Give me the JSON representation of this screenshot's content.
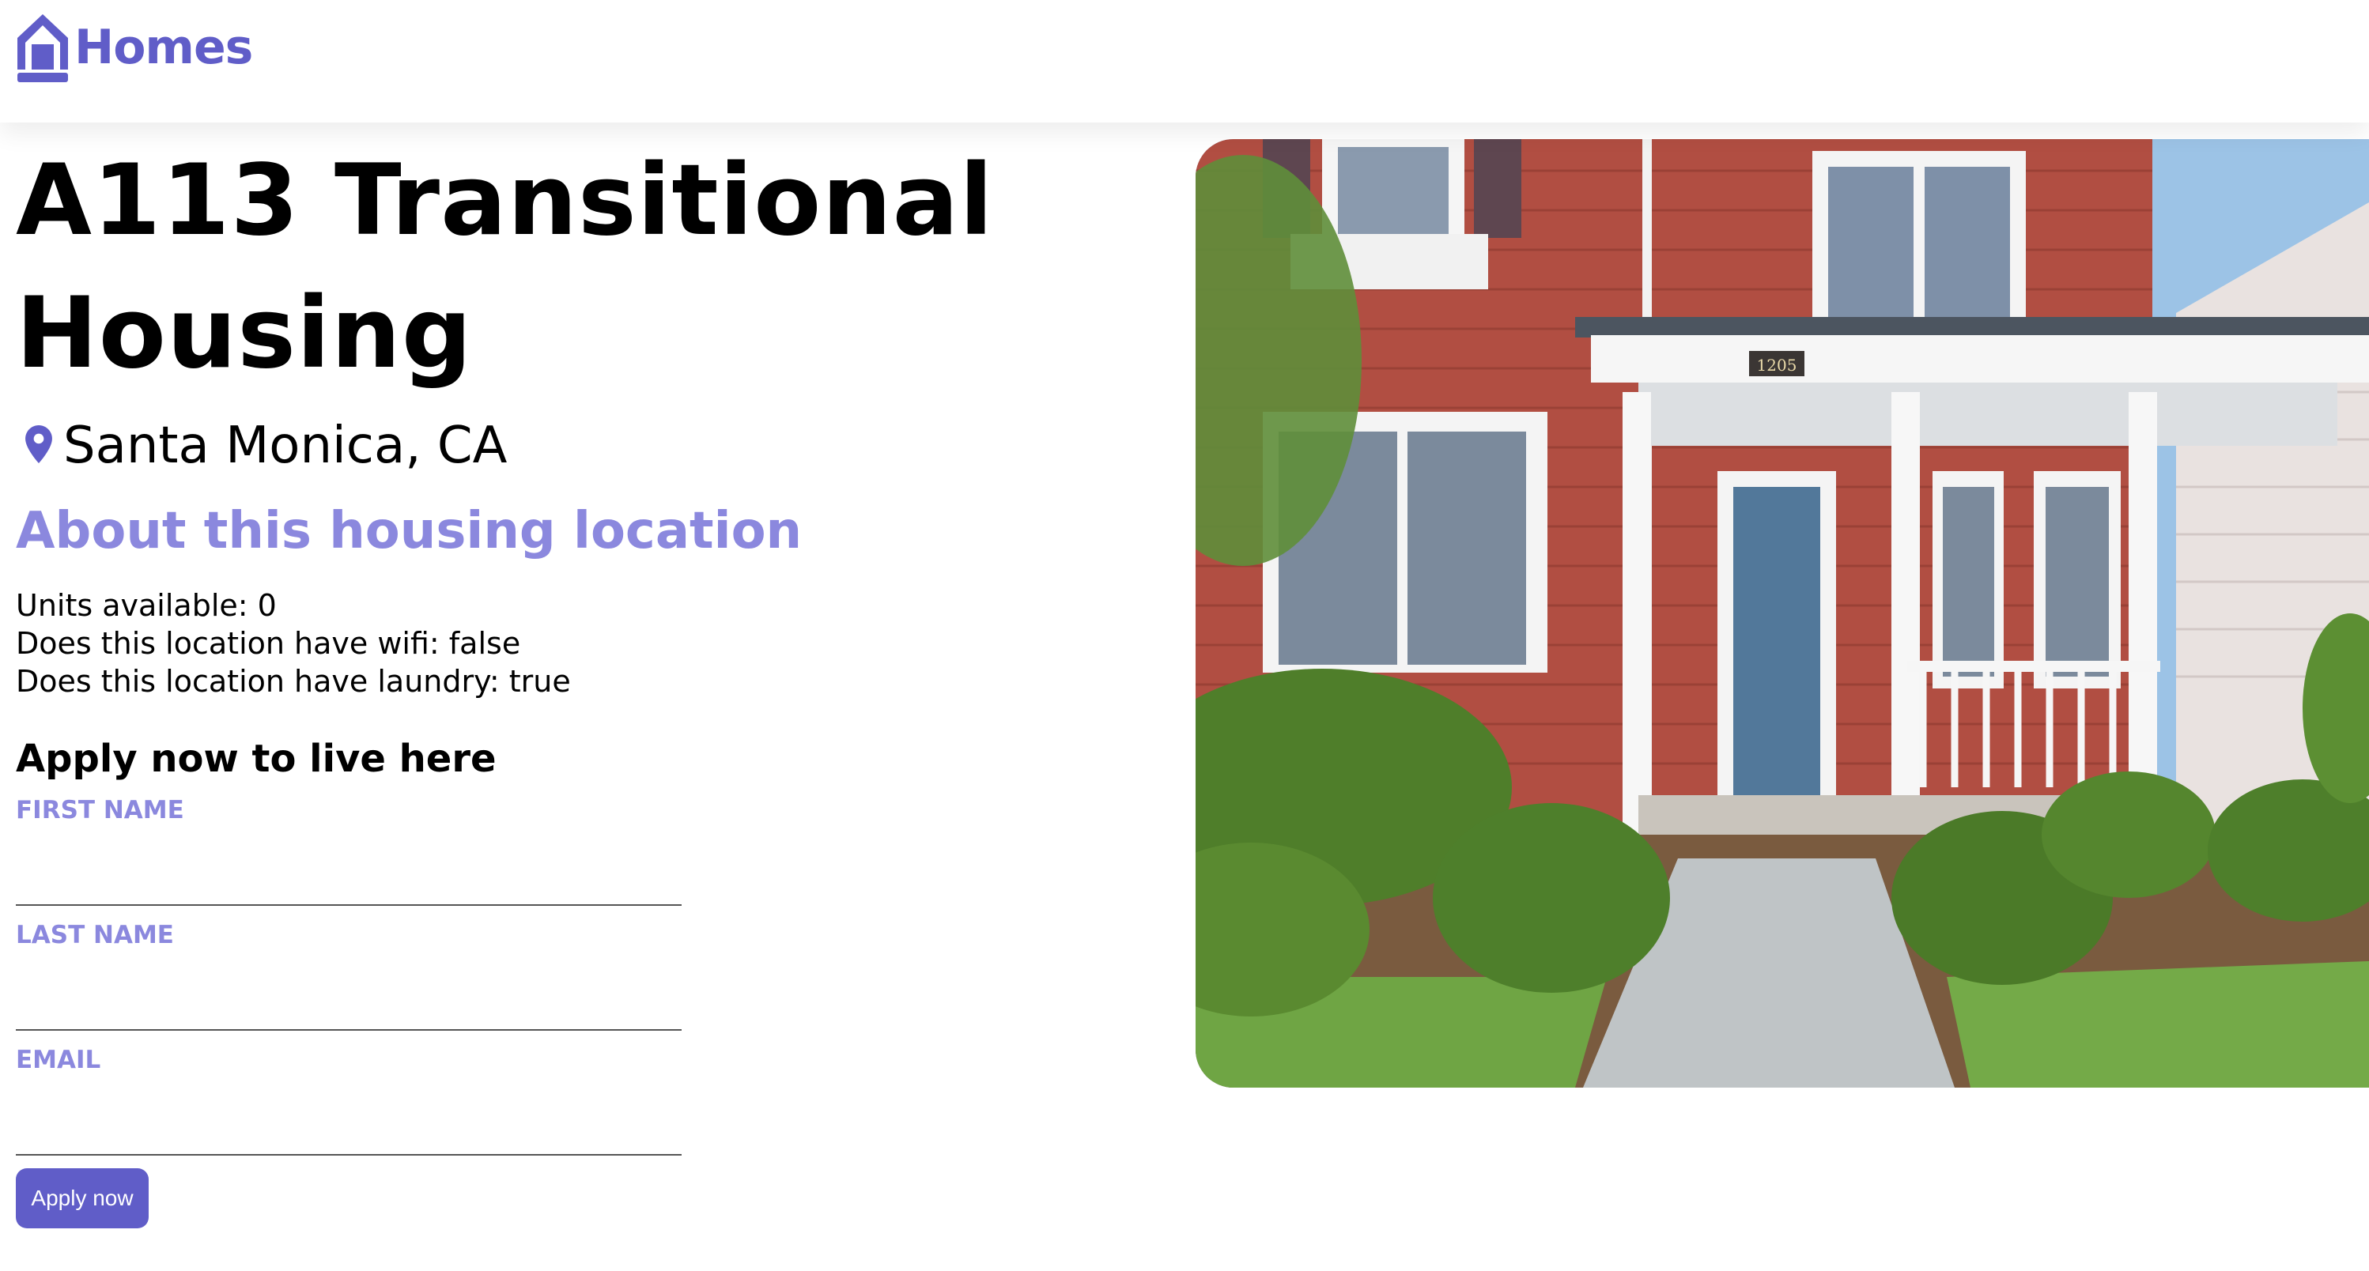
{
  "header": {
    "brand_label": "Homes",
    "brand_icon": "house-icon"
  },
  "listing": {
    "title": "A113 Transitional Housing",
    "location": "Santa Monica, CA",
    "location_icon": "map-pin-icon",
    "photo_alt": "Exterior of a red house with a white porch",
    "house_number": "1205",
    "about_heading": "About this housing location",
    "features": [
      "Units available: 0",
      "Does this location have wifi: false",
      "Does this location have laundry: true"
    ]
  },
  "application": {
    "heading": "Apply now to live here",
    "first_name_label": "FIRST NAME",
    "first_name_value": "",
    "last_name_label": "LAST NAME",
    "last_name_value": "",
    "email_label": "EMAIL",
    "email_value": "",
    "submit_label": "Apply now"
  },
  "colors": {
    "brand": "#605DC8",
    "accent_light": "#8B88DE"
  }
}
